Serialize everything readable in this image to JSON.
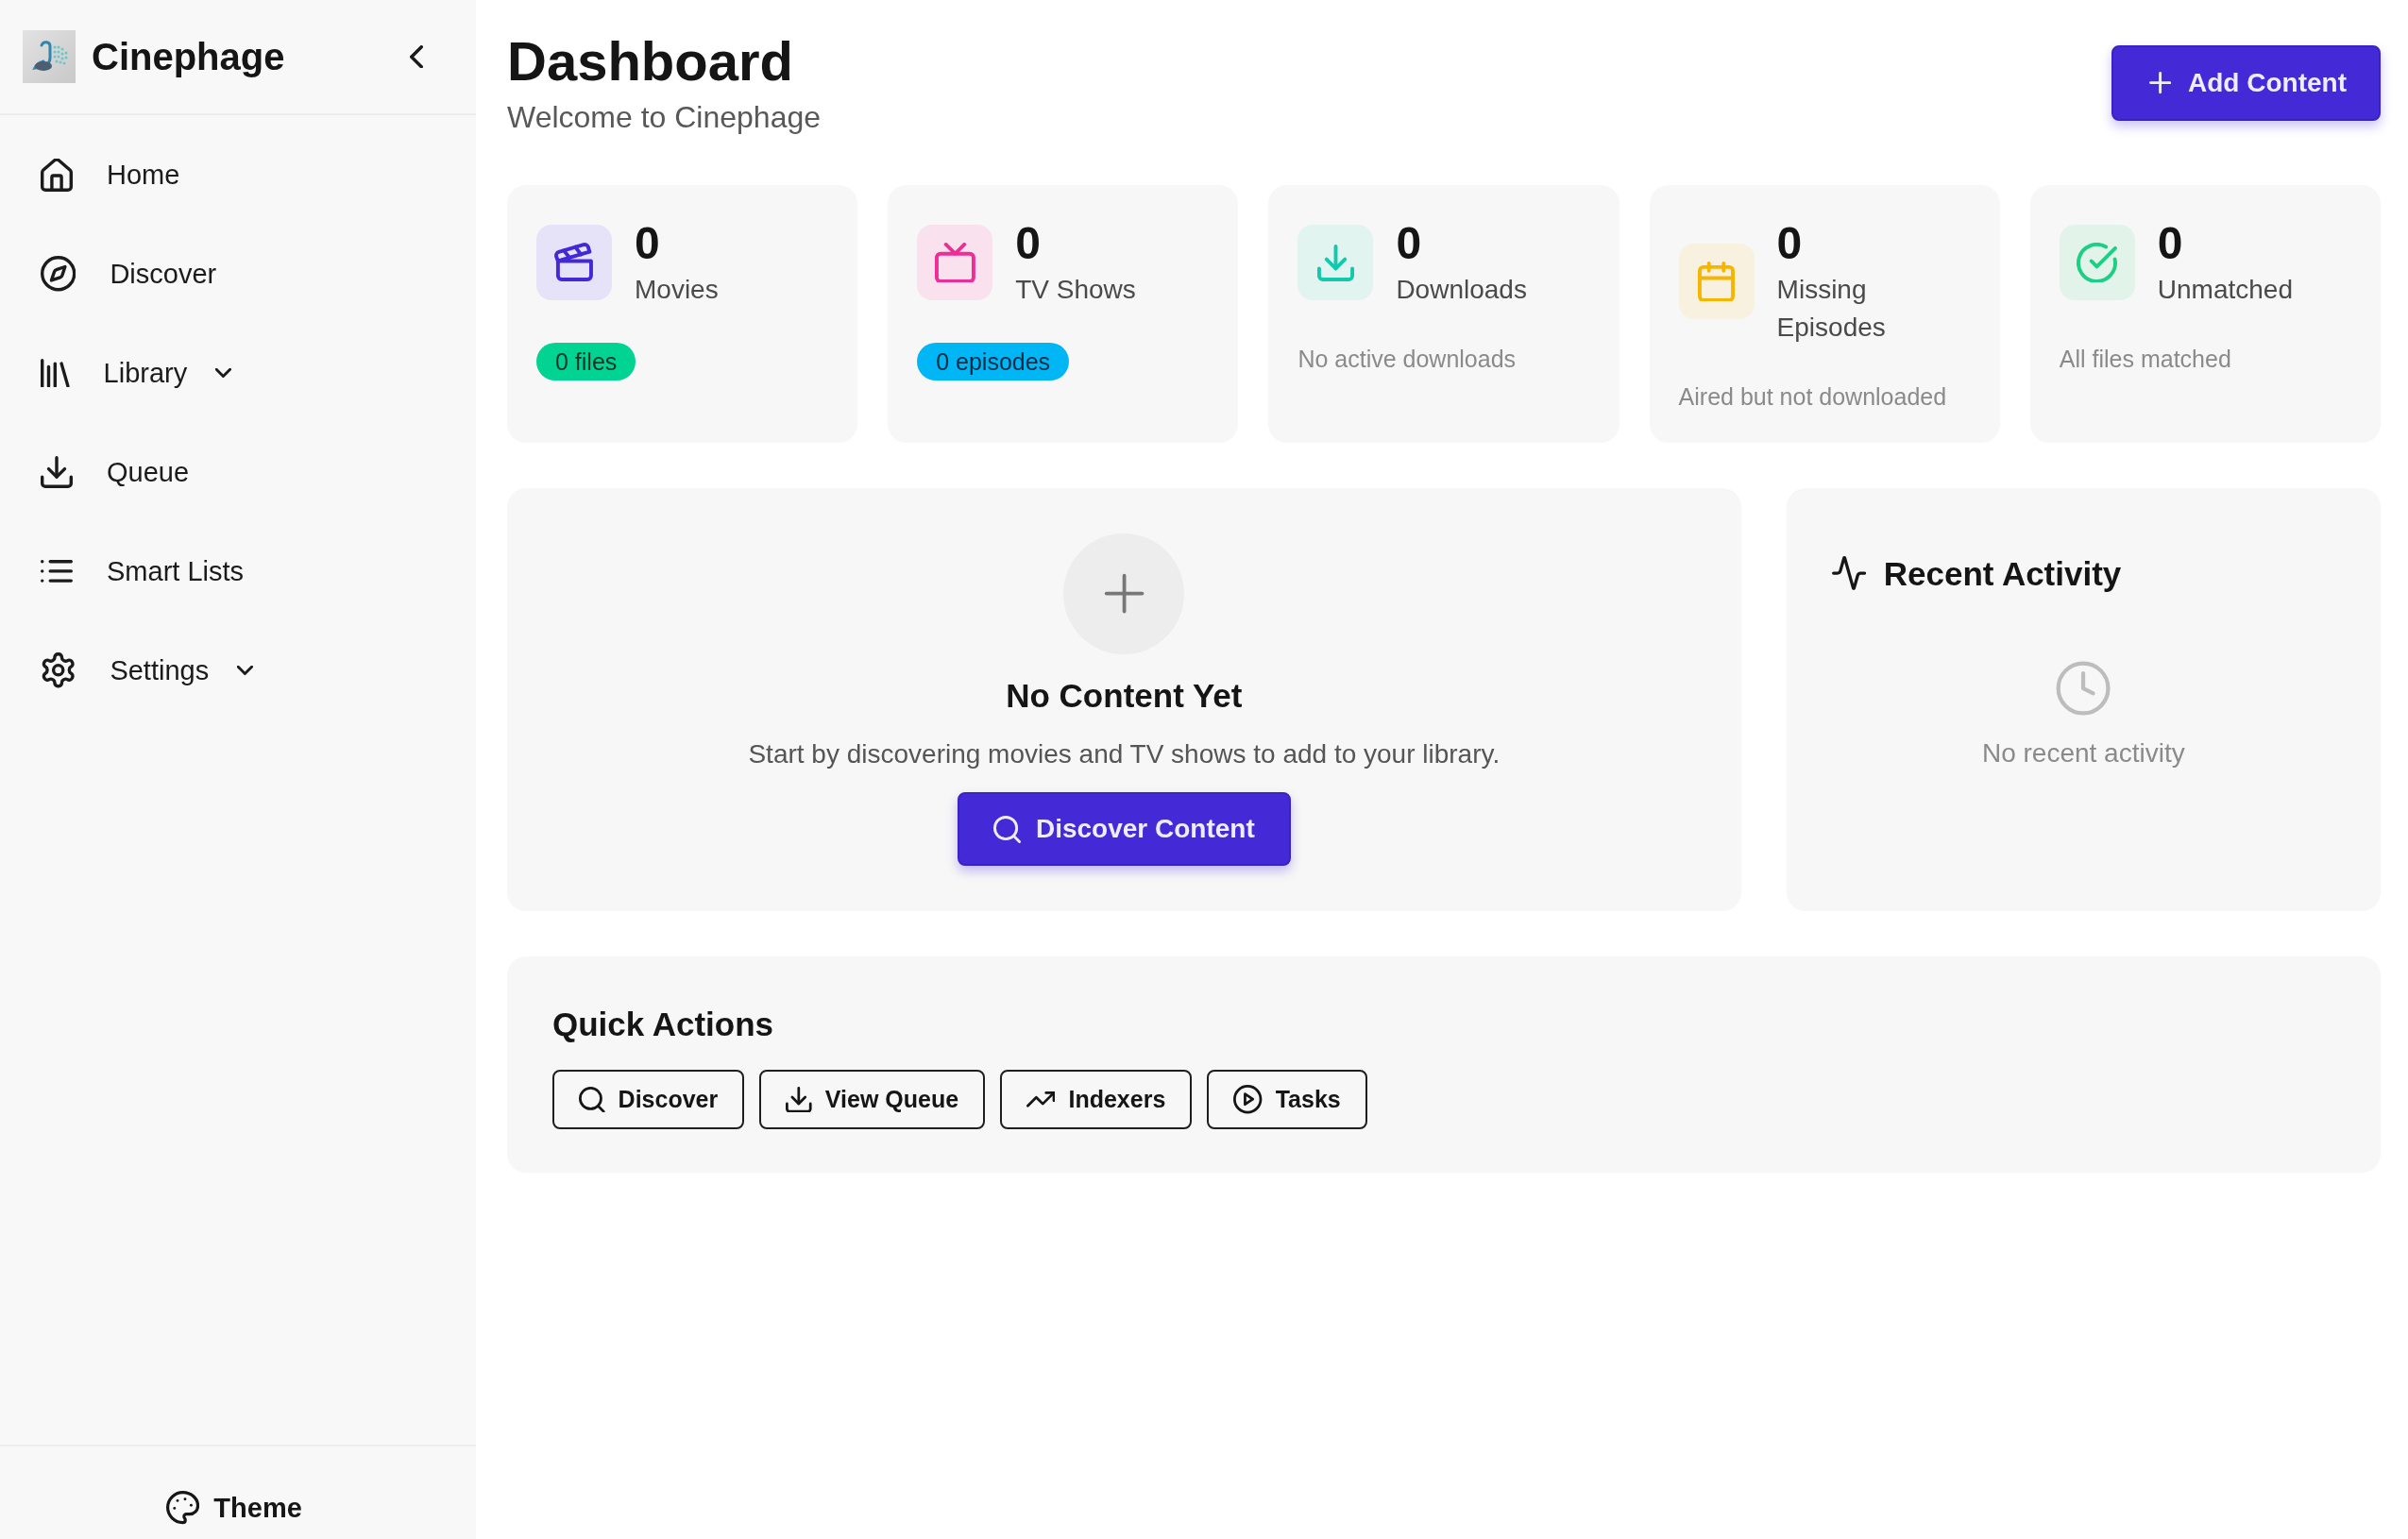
{
  "sidebar": {
    "brand": {
      "name": "Cinephage"
    },
    "nav": [
      {
        "kind": "link",
        "label": "Home"
      },
      {
        "kind": "link",
        "label": "Discover"
      },
      {
        "kind": "group",
        "label": "Library",
        "expanded": false
      },
      {
        "kind": "link",
        "label": "Queue"
      },
      {
        "kind": "link",
        "label": "Smart Lists"
      },
      {
        "kind": "group",
        "label": "Settings",
        "expanded": false
      }
    ],
    "footer": {
      "theme_button": "Theme"
    }
  },
  "header": {
    "title": "Dashboard",
    "subtitle": "Welcome to Cinephage",
    "primary_button": "Add Content"
  },
  "stats": [
    {
      "value": "0",
      "label": "Movies",
      "badge": "0 files"
    },
    {
      "value": "0",
      "label": "TV Shows",
      "badge": "0 episodes"
    },
    {
      "value": "0",
      "label": "Downloads",
      "caption": "No active downloads"
    },
    {
      "value": "0",
      "label": "Missing Episodes",
      "caption": "Aired but not downloaded"
    },
    {
      "value": "0",
      "label": "Unmatched",
      "caption": "All files matched"
    }
  ],
  "empty_state": {
    "title": "No Content Yet",
    "message": "Start by discovering movies and TV shows to add to your library.",
    "button": "Discover Content"
  },
  "recent_activity": {
    "title": "Recent Activity",
    "empty_message": "No recent activity"
  },
  "quick_actions": {
    "title": "Quick Actions",
    "buttons": [
      {
        "label": "Discover"
      },
      {
        "label": "View Queue"
      },
      {
        "label": "Indexers"
      },
      {
        "label": "Tasks"
      }
    ]
  }
}
